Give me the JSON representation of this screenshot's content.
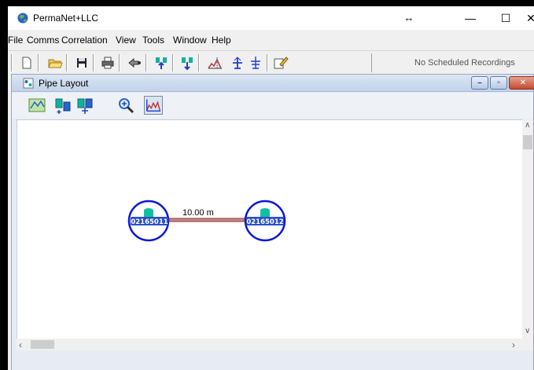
{
  "window": {
    "title": "PermaNet+LLC",
    "resize_glyph": "↔",
    "minimize_glyph": "—",
    "maximize_glyph": "☐",
    "close_glyph": "✕"
  },
  "menu": {
    "items": [
      {
        "label": "File"
      },
      {
        "label": "Comms"
      },
      {
        "label": "Correlation"
      },
      {
        "label": "View"
      },
      {
        "label": "Tools"
      },
      {
        "label": "Window"
      },
      {
        "label": "Help"
      }
    ]
  },
  "toolbar": {
    "buttons": [
      "new-file-icon",
      "open-folder-icon",
      "save-disk-icon",
      "print-icon",
      "comms-plug-icon",
      "upload-logger-icon",
      "download-logger-icon",
      "correlation-chart-icon",
      "antenna-icon",
      "antenna-grid-icon",
      "edit-note-icon"
    ],
    "status_text": "No Scheduled Recordings"
  },
  "child_window": {
    "title": "Pipe Layout",
    "minimize_glyph": "–",
    "restore_glyph": "▫",
    "close_glyph": "✕",
    "tools": [
      "map-icon",
      "add-logger-icon",
      "move-logger-icon",
      "zoom-icon",
      "correlation-view-icon"
    ]
  },
  "pipe_layout": {
    "nodes": [
      {
        "id": "02165011"
      },
      {
        "id": "02165012"
      }
    ],
    "segment_label": "10.00 m"
  },
  "colors": {
    "node_ring": "#0a18d6",
    "node_body": "#11c0a0",
    "pipe_red": "#d81818",
    "pipe_gray": "#9a9a9a"
  }
}
